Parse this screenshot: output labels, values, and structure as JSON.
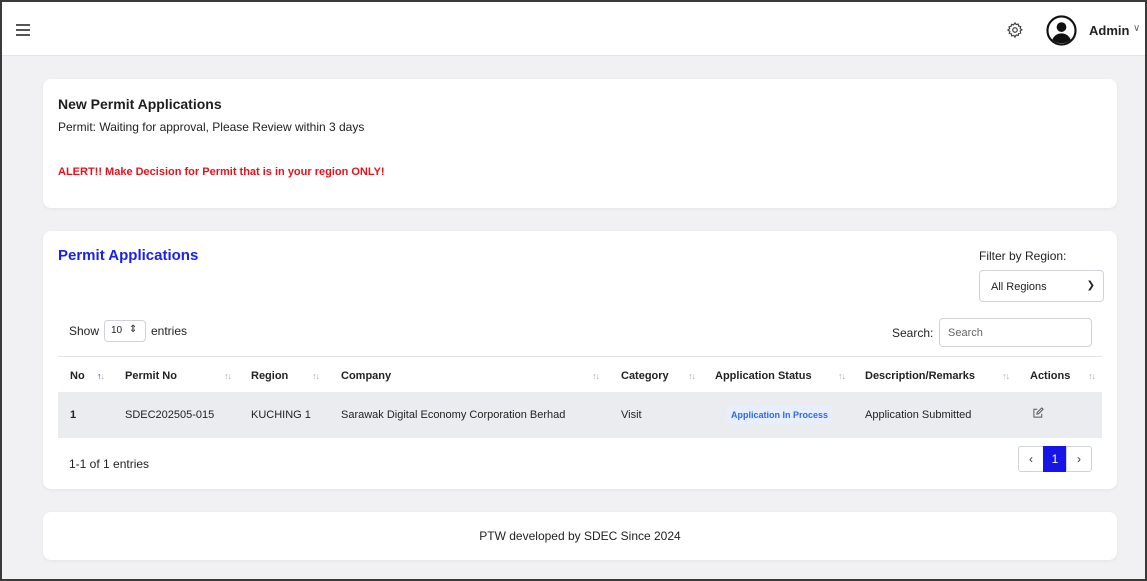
{
  "header": {
    "menu_icon": "hamburger-icon",
    "settings_icon": "gear-icon",
    "avatar_icon": "user-circle-icon",
    "user_name": "Admin",
    "user_caret": "chevron-down-icon"
  },
  "notice": {
    "title": "New Permit Applications",
    "subtitle": "Permit: Waiting for approval, Please Review within 3 days",
    "alert": "ALERT!! Make Decision for Permit that is in your region ONLY!",
    "alert_color": "#e8111b"
  },
  "applications": {
    "title": "Permit Applications",
    "title_color": "#1a22e8",
    "filter_label": "Filter by Region:",
    "region_selected": "All Regions",
    "show_label": "Show",
    "page_length": "10",
    "entries_label": "entries",
    "search_label": "Search:",
    "search_placeholder": "Search",
    "columns": [
      "No",
      "Permit No",
      "Region",
      "Company",
      "Category",
      "Application Status",
      "Description/Remarks",
      "Actions"
    ],
    "rows": [
      {
        "no": "1",
        "permit_no": "SDEC202505-015",
        "region": "KUCHING 1",
        "company": "Sarawak Digital Economy Corporation Berhad",
        "category": "Visit",
        "status": "Application In Process",
        "remarks": "Application Submitted",
        "action_icon": "edit-icon"
      }
    ],
    "info": "1-1 of 1 entries",
    "pagination": {
      "prev": "‹",
      "current": "1",
      "next": "›"
    },
    "accent_color": "#1714e6"
  },
  "footer": {
    "text": "PTW developed by SDEC Since 2024"
  }
}
